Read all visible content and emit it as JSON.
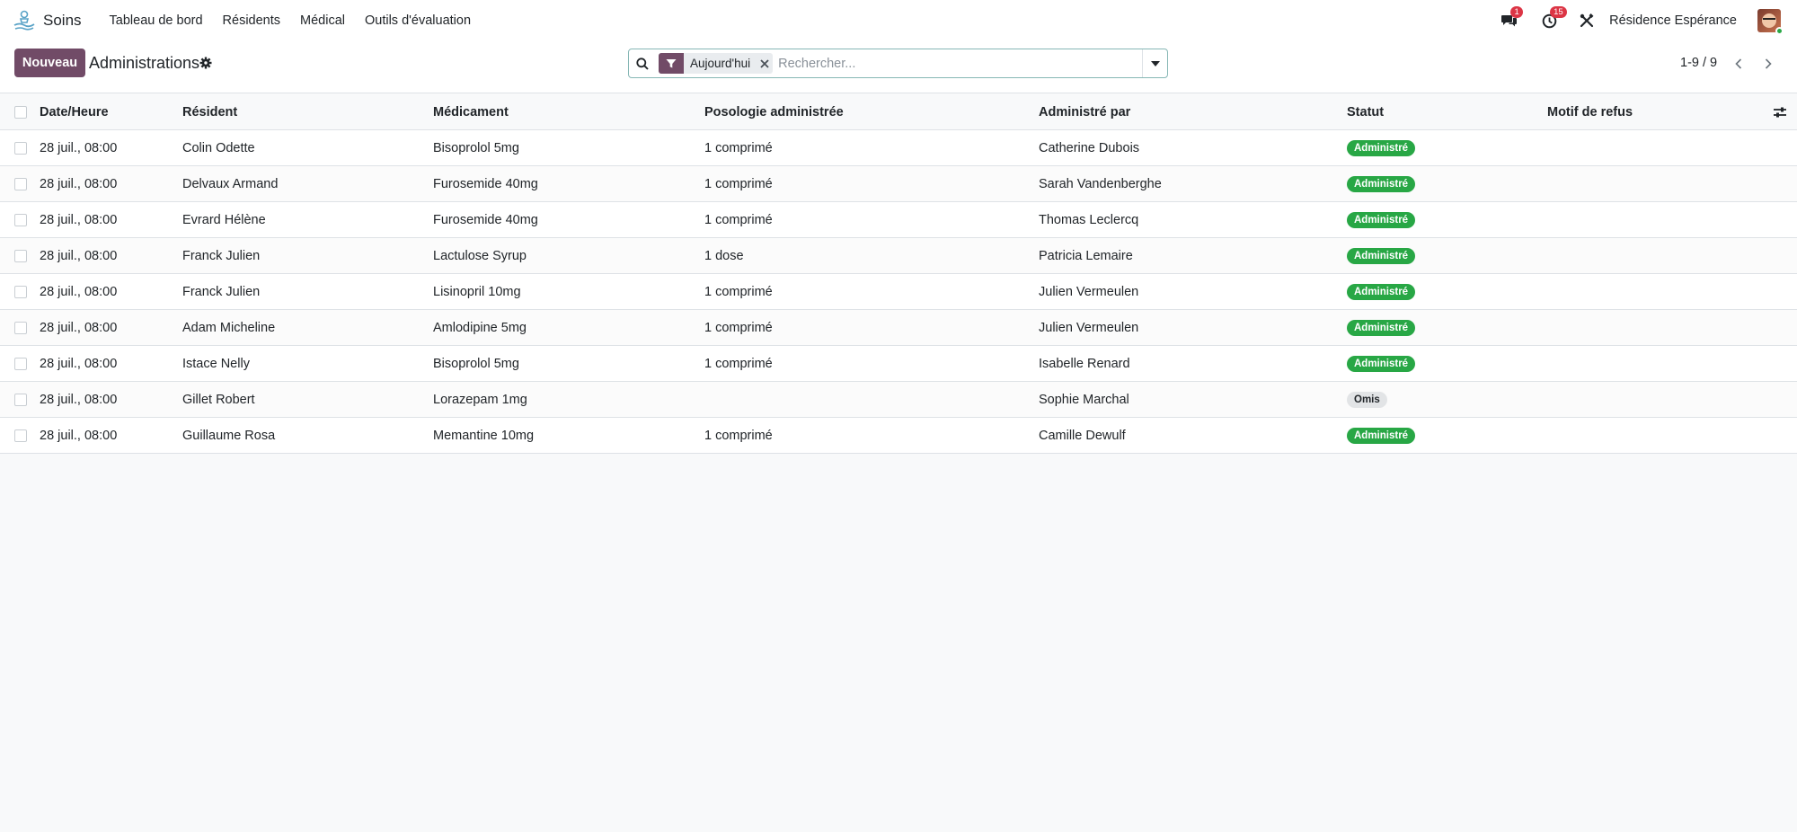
{
  "app": {
    "name": "Soins",
    "menu": [
      "Tableau de bord",
      "Résidents",
      "Médical",
      "Outils d'évaluation"
    ],
    "messages_count": "1",
    "activities_count": "15",
    "company": "Résidence Espérance"
  },
  "control": {
    "new_label": "Nouveau",
    "title": "Administrations",
    "facet": "Aujourd'hui",
    "search_placeholder": "Rechercher...",
    "pager": "1-9 / 9"
  },
  "table": {
    "columns": [
      "Date/Heure",
      "Résident",
      "Médicament",
      "Posologie administrée",
      "Administré par",
      "Statut",
      "Motif de refus"
    ],
    "rows": [
      {
        "date": "28 juil., 08:00",
        "resident": "Colin Odette",
        "medicament": "Bisoprolol 5mg",
        "posologie": "1 comprimé",
        "administre_par": "Catherine Dubois",
        "statut": "Administré",
        "motif": ""
      },
      {
        "date": "28 juil., 08:00",
        "resident": "Delvaux Armand",
        "medicament": "Furosemide 40mg",
        "posologie": "1 comprimé",
        "administre_par": "Sarah Vandenberghe",
        "statut": "Administré",
        "motif": ""
      },
      {
        "date": "28 juil., 08:00",
        "resident": "Evrard Hélène",
        "medicament": "Furosemide 40mg",
        "posologie": "1 comprimé",
        "administre_par": "Thomas Leclercq",
        "statut": "Administré",
        "motif": ""
      },
      {
        "date": "28 juil., 08:00",
        "resident": "Franck Julien",
        "medicament": "Lactulose Syrup",
        "posologie": "1 dose",
        "administre_par": "Patricia Lemaire",
        "statut": "Administré",
        "motif": ""
      },
      {
        "date": "28 juil., 08:00",
        "resident": "Franck Julien",
        "medicament": "Lisinopril 10mg",
        "posologie": "1 comprimé",
        "administre_par": "Julien Vermeulen",
        "statut": "Administré",
        "motif": ""
      },
      {
        "date": "28 juil., 08:00",
        "resident": "Adam Micheline",
        "medicament": "Amlodipine 5mg",
        "posologie": "1 comprimé",
        "administre_par": "Julien Vermeulen",
        "statut": "Administré",
        "motif": ""
      },
      {
        "date": "28 juil., 08:00",
        "resident": "Istace Nelly",
        "medicament": "Bisoprolol 5mg",
        "posologie": "1 comprimé",
        "administre_par": "Isabelle Renard",
        "statut": "Administré",
        "motif": ""
      },
      {
        "date": "28 juil., 08:00",
        "resident": "Gillet Robert",
        "medicament": "Lorazepam 1mg",
        "posologie": "",
        "administre_par": "Sophie Marchal",
        "statut": "Omis",
        "motif": ""
      },
      {
        "date": "28 juil., 08:00",
        "resident": "Guillaume Rosa",
        "medicament": "Memantine 10mg",
        "posologie": "1 comprimé",
        "administre_par": "Camille Dewulf",
        "statut": "Administré",
        "motif": ""
      }
    ]
  },
  "colors": {
    "primary": "#714B67",
    "status_administered": "#28a745",
    "status_omitted": "#e2e4e6",
    "badge": "#dc3545"
  },
  "icons": [
    "app-logo-icon",
    "chat-icon",
    "clock-icon",
    "tools-icon",
    "gear-icon",
    "search-icon",
    "filter-icon",
    "close-icon",
    "caret-down-icon",
    "chevron-left-icon",
    "chevron-right-icon",
    "column-options-icon"
  ]
}
